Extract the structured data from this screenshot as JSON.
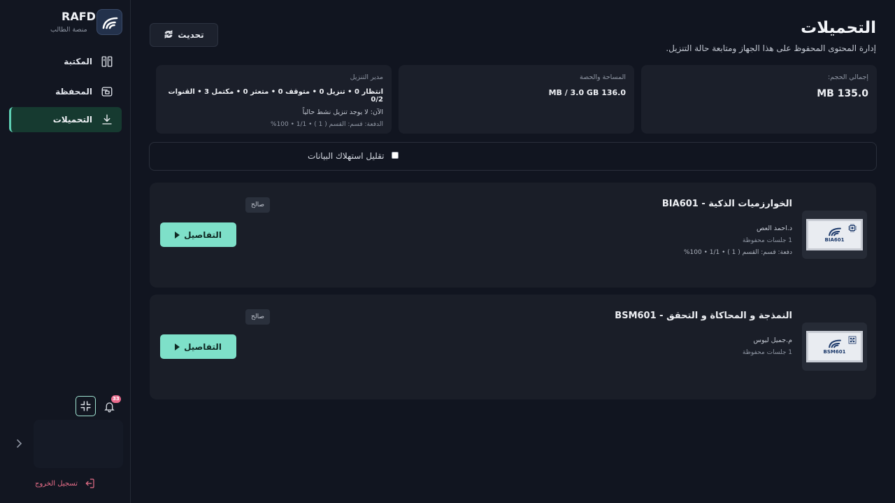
{
  "sidebar": {
    "brand_name": "RAFD",
    "brand_sub": "منصة الطالب",
    "nav": {
      "library": "المكتبة",
      "wallet": "المحفظة",
      "downloads": "التحميلات"
    },
    "notification_count": "33",
    "logout": "تسجيل الخروج"
  },
  "header": {
    "title": "التحميلات",
    "subtitle": "إدارة المحتوى المحفوظ على هذا الجهاز ومتابعة حالة التنزيل.",
    "refresh_label": "تحديث"
  },
  "stats": {
    "total_label": "إجمالي الحجم:",
    "total_value": "135.0 MB",
    "quota_label": "المساحة والحصة",
    "quota_value": "136.0 MB / 3.0 GB",
    "manager_label": "مدير التنزيل",
    "manager_status": "انتظار 0 • تنزيل 0 • متوقف 0 • متعثر 0 • مكتمل 3 • القنوات 0/2",
    "manager_now": "الآن: لا يوجد تنزيل نشط حالياً",
    "manager_batch": "الدفعة: قسم: القسم ( 1 ) • 1/1 • 100%"
  },
  "data_saver": {
    "label": "تقليل استهلاك البيانات",
    "checked": false
  },
  "courses": [
    {
      "title": "الخوارزميات الذكية - BIA601",
      "code": "BIA601",
      "teacher": "د.احمد العص",
      "sessions": "1 جلسات محفوظة",
      "batch": "دفعة: قسم: القسم ( 1 ) • 1/1 • 100%",
      "badge": "صالح",
      "details": "التفاصيل"
    },
    {
      "title": "النمذجة و المحاكاة و التحقق - BSM601",
      "code": "BSM601",
      "teacher": "م.جميل ليوس",
      "sessions": "1 جلسات محفوظة",
      "badge": "صالح",
      "details": "التفاصيل"
    }
  ],
  "colors": {
    "background": "#111520",
    "accent": "#7ee0c9",
    "active_nav": "#163a30",
    "logout": "#ea6f8a",
    "badge": "#e96a8c"
  },
  "icons": {
    "brand": "rafd-logo-icon",
    "library": "books-icon",
    "wallet": "wallet-icon",
    "downloads": "download-icon",
    "refresh": "refresh-icon",
    "collapse": "collapse-icon",
    "bell": "bell-icon",
    "chevron": "chevron-right-icon",
    "logout": "logout-icon",
    "play": "play-icon"
  }
}
